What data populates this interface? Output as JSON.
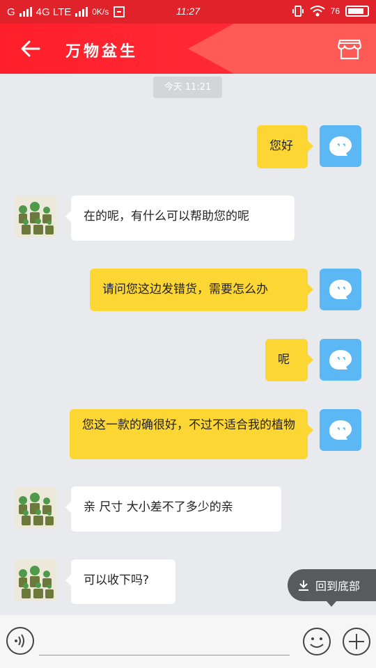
{
  "status_bar": {
    "network_left": "G",
    "network_type": "4G LTE",
    "speed": "0K/s",
    "time": "11:27",
    "battery": "76"
  },
  "header": {
    "title": "万物盆生"
  },
  "chat": {
    "time_label": "今天 11:21",
    "messages": [
      {
        "side": "out",
        "text": "您好"
      },
      {
        "side": "in",
        "text": "在的呢，有什么可以帮助您的呢"
      },
      {
        "side": "out",
        "text": "请问您这边发错货，需要怎么办"
      },
      {
        "side": "out",
        "text": "呢"
      },
      {
        "side": "out",
        "text": "您这一款的确很好，不过不适合我的植物"
      },
      {
        "side": "in",
        "text": "亲 尺寸 大小差不了多少的亲"
      },
      {
        "side": "in",
        "text": "可以收下吗?"
      }
    ]
  },
  "scroll_bottom": {
    "label": "回到底部"
  },
  "input_bar": {
    "value": "",
    "placeholder": ""
  },
  "colors": {
    "brand_red": "#e0232b",
    "outgoing_bubble": "#fcd633",
    "incoming_bubble": "#ffffff",
    "self_avatar": "#5cb8f5"
  }
}
